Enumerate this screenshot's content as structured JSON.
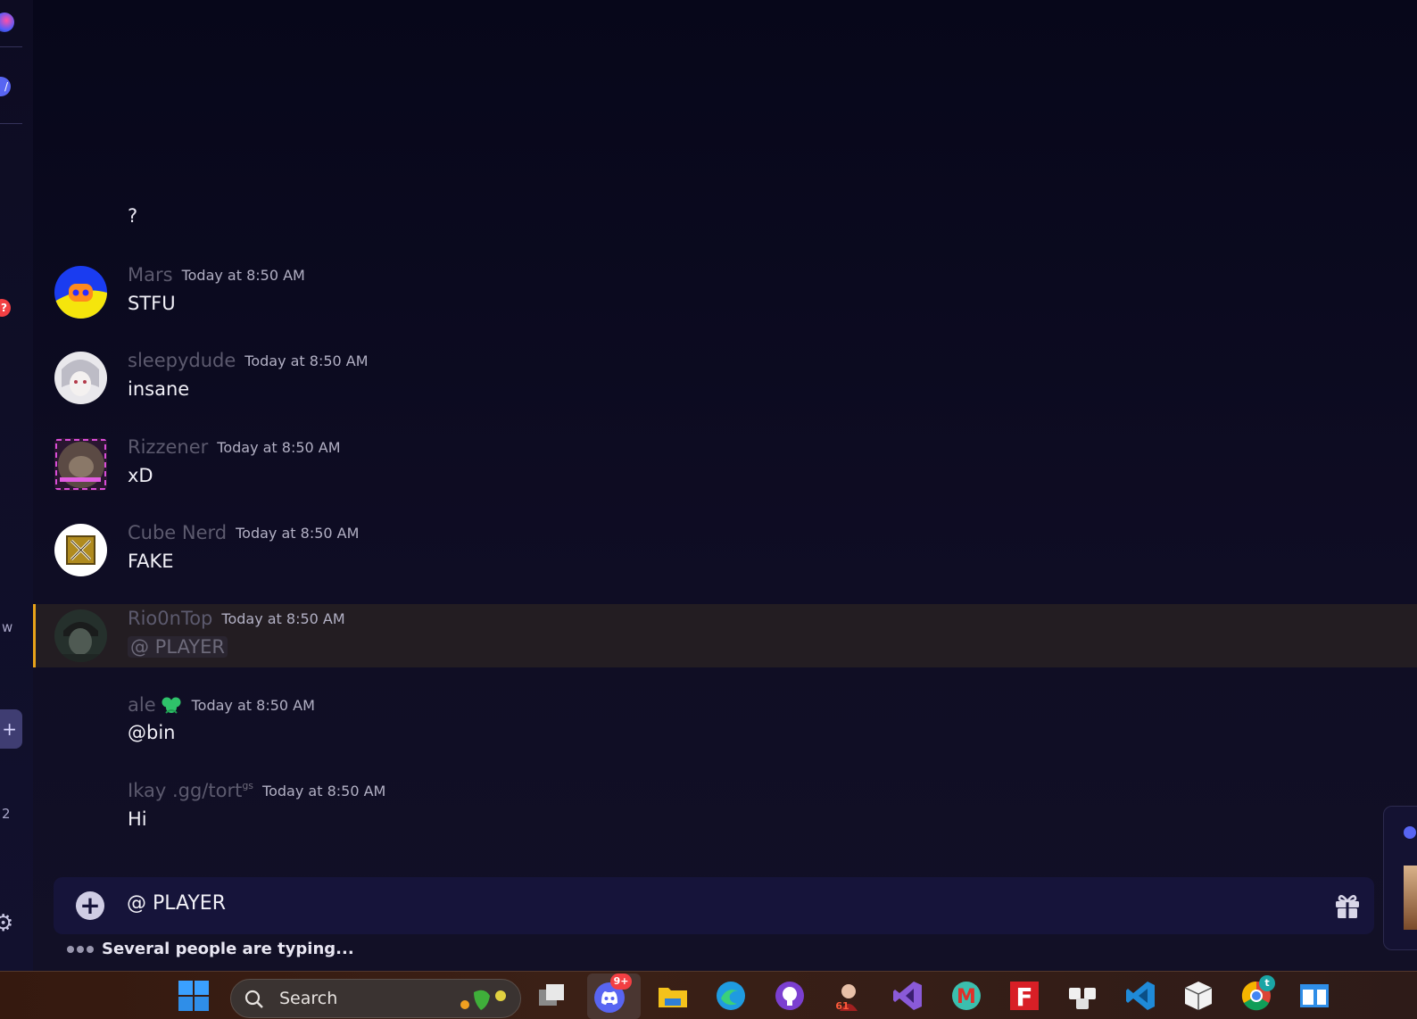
{
  "chat": {
    "lone_message": "?",
    "messages": [
      {
        "username": "Mars",
        "timestamp": "Today at 8:50 AM",
        "text": "STFU"
      },
      {
        "username": "sleepydude",
        "timestamp": "Today at 8:50 AM",
        "text": "insane"
      },
      {
        "username": "Rizzener",
        "timestamp": "Today at 8:50 AM",
        "text": "xD"
      },
      {
        "username": "Cube Nerd",
        "timestamp": "Today at 8:50 AM",
        "text": "FAKE"
      },
      {
        "username": "Rio0nTop",
        "timestamp": "Today at 8:50 AM",
        "text": "@ PLAYER"
      },
      {
        "username": "ale",
        "timestamp": "Today at 8:50 AM",
        "text": "@bin"
      },
      {
        "username": "Ikay .gg/tort",
        "tag_suffix": "gs",
        "timestamp": "Today at 8:50 AM",
        "text": "Hi"
      }
    ]
  },
  "composer": {
    "text": "@ PLAYER",
    "typing_indicator": "Several people are typing..."
  },
  "sidebar": {
    "side_text_1": "w",
    "side_text_2": "2"
  },
  "taskbar": {
    "search_placeholder": "Search",
    "discord_badge": "9+",
    "chrome_badge": "t",
    "profile_badge": "61"
  },
  "colors": {
    "mention_border": "#e8a31a",
    "mention_bg": "#231d22",
    "discord_blurple": "#5865f2",
    "notification_red": "#f23f43"
  }
}
